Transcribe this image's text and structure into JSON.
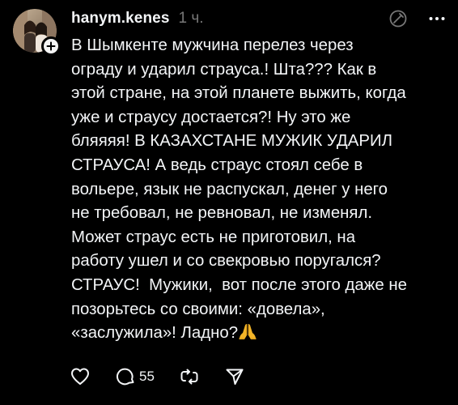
{
  "post": {
    "username": "hanym.kenes",
    "timestamp": "1 ч.",
    "text": "В Шымкенте мужчина перелез через\nограду и ударил страуса.! Шта??? Как в\nэтой стране, на этой планете выжить, когда\nуже и страусу достается?! Ну это же\nбляяяя! В КАЗАХСТАНЕ МУЖИК УДАРИЛ\nСТРАУСА! А ведь страус стоял себе в\nвольере, язык не распускал, денег у него\nне требовал, не ревновал, не изменял.\nМожет страус есть не приготовил, на\nработу ушел и со свекровью поругался?\nСТРАУС!  Мужики,  вот после этого даже не\nпозорьтесь со своими: «довела»,\n«заслужила»! Ладно?",
    "emoji": "🙏"
  },
  "actions": {
    "reply_count": "55"
  },
  "icons": {
    "follow": "plus-icon",
    "ai": "ai-info-icon",
    "more": "more-icon",
    "like": "heart-icon",
    "reply": "comment-icon",
    "repost": "repost-icon",
    "share": "send-icon"
  },
  "colors": {
    "background": "#000000",
    "text": "#f3f5f7",
    "muted": "#777777",
    "emoji": "#f2b428"
  }
}
